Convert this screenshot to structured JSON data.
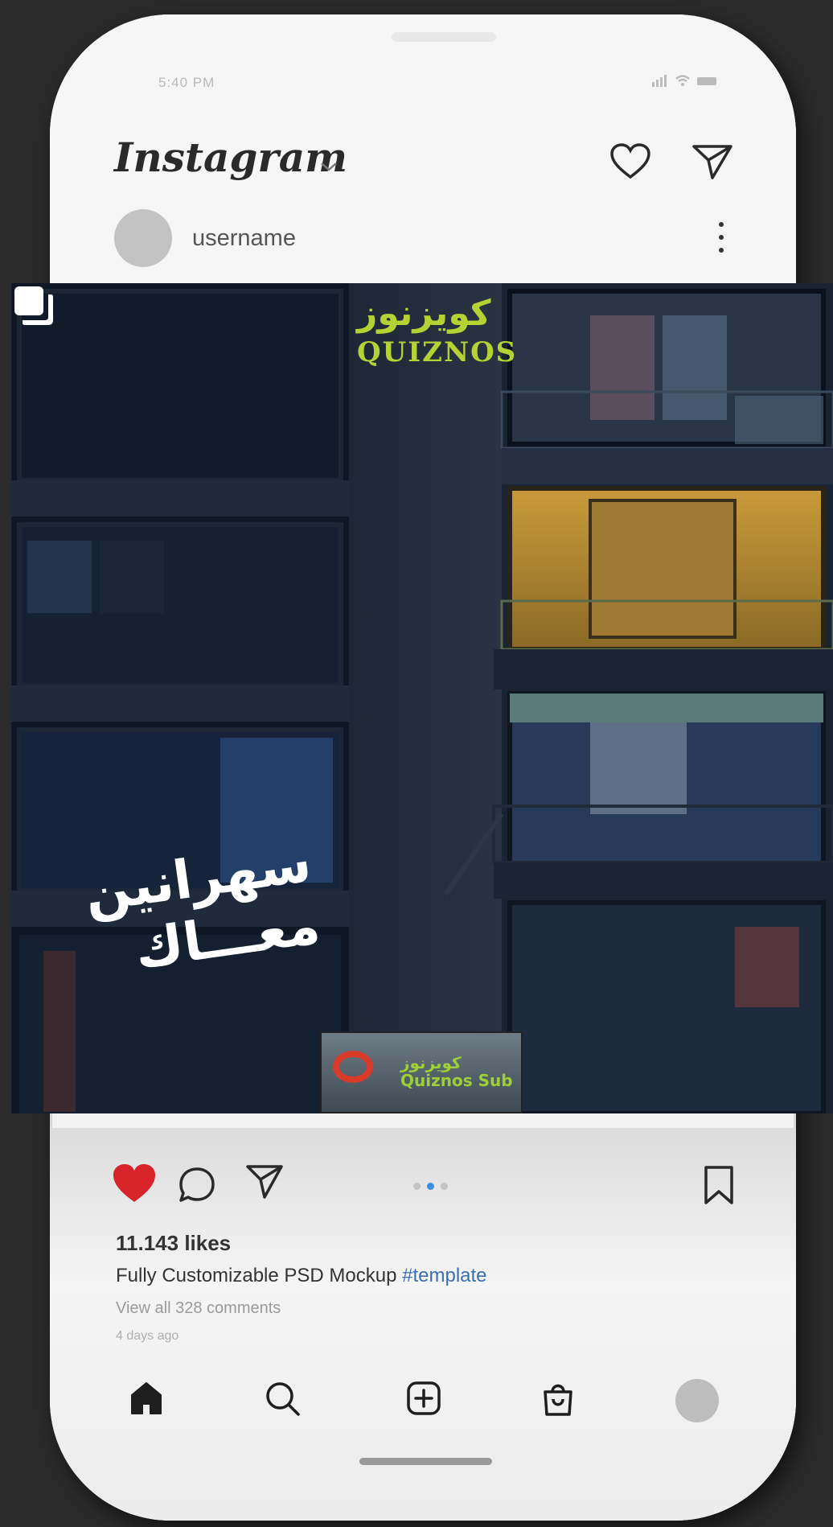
{
  "status_bar": {
    "time": "5:40 PM",
    "indicators": "▐▐ ◡ ▬"
  },
  "header": {
    "title": "Instagram",
    "chevron": "⌄"
  },
  "post": {
    "username": "username",
    "logo_arabic": "كويزنوز",
    "logo_latin": "QUIZNOS",
    "headline_line1": "سهرانين",
    "headline_line2": "معـــاك",
    "sign_arabic": "كويزنوز",
    "sign_latin": "Quiznos Sub"
  },
  "actions": {
    "carousel_dots": 3,
    "carousel_active": 2
  },
  "likes": "11.143 likes",
  "caption": {
    "text": "Fully Customizable PSD Mockup ",
    "hashtag": "#template"
  },
  "view_all_comments": "View all 328 comments",
  "time_ago": "4 days ago",
  "colors": {
    "like_red": "#d8232a",
    "hashtag_blue": "#3a6fb4",
    "logo_green": "#b5d234"
  }
}
